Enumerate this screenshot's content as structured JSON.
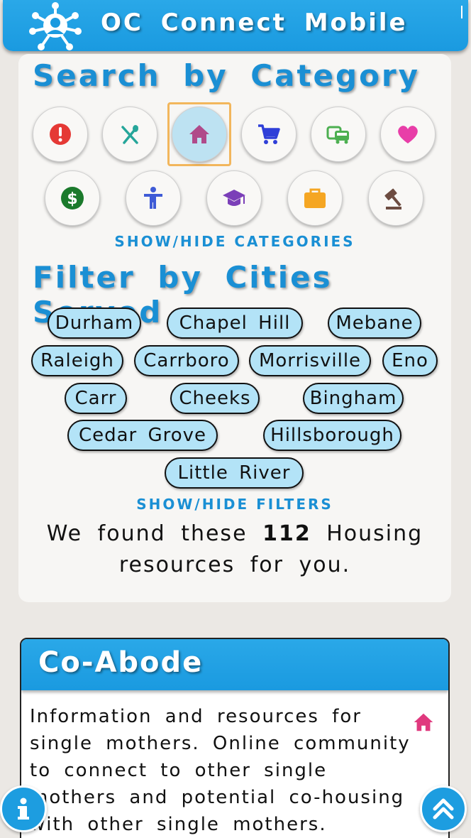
{
  "app": {
    "title": "OC Connect Mobile"
  },
  "search": {
    "title": "Search by Category",
    "categories": [
      {
        "icon": "alert-icon",
        "color": "#e53935"
      },
      {
        "icon": "utensils-icon",
        "color": "#26a69a"
      },
      {
        "icon": "home-icon",
        "color": "#b04a8a",
        "selected": true
      },
      {
        "icon": "cart-icon",
        "color": "#2f3fd8"
      },
      {
        "icon": "bus-icon",
        "color": "#4caf50"
      },
      {
        "icon": "heart-icon",
        "color": "#e83ea8"
      },
      {
        "icon": "dollar-icon",
        "color": "#1b7a2c"
      },
      {
        "icon": "accessibility-icon",
        "color": "#3f5bd6"
      },
      {
        "icon": "graduation-cap-icon",
        "color": "#7b3fb8"
      },
      {
        "icon": "briefcase-icon",
        "color": "#f5a623"
      },
      {
        "icon": "gavel-icon",
        "color": "#6d4c41"
      }
    ],
    "toggle_label": "SHOW/HIDE CATEGORIES"
  },
  "filter": {
    "title": "Filter by Cities Served",
    "cities": [
      "Durham",
      "Chapel Hill",
      "Mebane",
      "Raleigh",
      "Carrboro",
      "Morrisville",
      "Eno",
      "Carr",
      "Cheeks",
      "Bingham",
      "Cedar Grove",
      "Hillsborough",
      "Little River"
    ],
    "toggle_label": "SHOW/HIDE FILTERS"
  },
  "results": {
    "prefix": "We found these",
    "count": "112",
    "category": "Housing",
    "suffix": "resources for you."
  },
  "listing": {
    "title": "Co-Abode",
    "description": "Information and resources for single mothers. Online community to connect to other single mothers and potential co-housing with other single mothers.",
    "icon": "home-icon"
  },
  "colors": {
    "accent": "#1a9ae0",
    "chip": "#b3e3f7",
    "selected_frame": "#f2b65c"
  }
}
